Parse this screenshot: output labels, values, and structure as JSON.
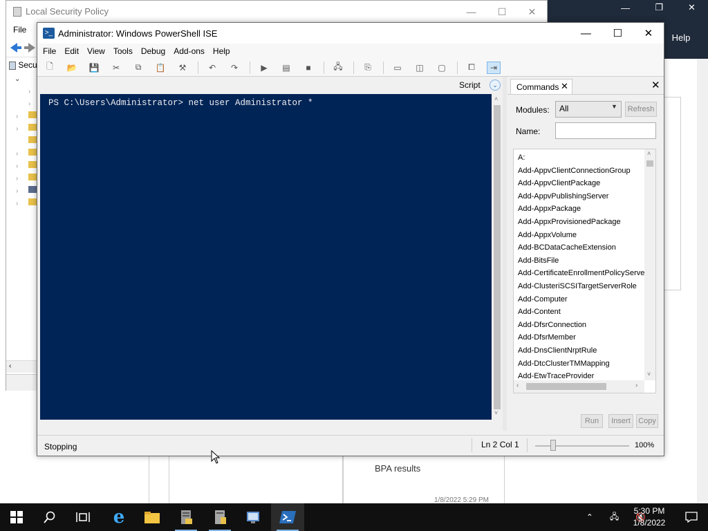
{
  "background": {
    "help_label": "Help",
    "bpa_label": "BPA results",
    "bpa_date": "1/8/2022 5:29 PM"
  },
  "lsp": {
    "title": "Local Security Policy",
    "menu_file": "File",
    "tree_partial": "Secu"
  },
  "ise": {
    "title": "Administrator: Windows PowerShell ISE",
    "menu": [
      "File",
      "Edit",
      "View",
      "Tools",
      "Debug",
      "Add-ons",
      "Help"
    ],
    "script_label": "Script",
    "console_line": "PS C:\\Users\\Administrator> net user Administrator *",
    "status_text": "Stopping",
    "status_position": "Ln 2  Col 1",
    "zoom": "100%"
  },
  "commands": {
    "tab_label": "Commands",
    "modules_label": "Modules:",
    "modules_value": "All",
    "refresh_label": "Refresh",
    "name_label": "Name:",
    "name_value": "",
    "items": [
      "A:",
      "Add-AppvClientConnectionGroup",
      "Add-AppvClientPackage",
      "Add-AppvPublishingServer",
      "Add-AppxPackage",
      "Add-AppxProvisionedPackage",
      "Add-AppxVolume",
      "Add-BCDataCacheExtension",
      "Add-BitsFile",
      "Add-CertificateEnrollmentPolicyServer",
      "Add-ClusteriSCSITargetServerRole",
      "Add-Computer",
      "Add-Content",
      "Add-DfsrConnection",
      "Add-DfsrMember",
      "Add-DnsClientNrptRule",
      "Add-DtcClusterTMMapping",
      "Add-EtwTraceProvider"
    ],
    "run_label": "Run",
    "insert_label": "Insert",
    "copy_label": "Copy"
  },
  "taskbar": {
    "time": "5:30 PM",
    "date": "1/8/2022",
    "accent": "#7fb3e3"
  }
}
